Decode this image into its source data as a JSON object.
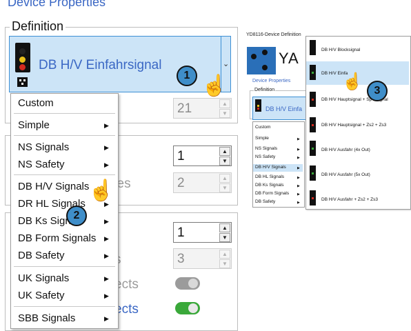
{
  "left": {
    "header": "Device Properties",
    "definition_legend": "Definition",
    "selected_type": "DB H/V Einfahrsignal",
    "id_value": "21",
    "spinner2_value": "1",
    "spinner3_value": "2",
    "ghost_text_1": "ses",
    "spinner4_value": "1",
    "spinner5_value": "3",
    "ghost_text_2": "s",
    "ghost_text_3": "ects",
    "ghost_text_4": "ects",
    "menu": [
      {
        "label": "Custom",
        "submenu": false
      },
      {
        "label": "Simple",
        "submenu": true
      },
      {
        "label": "NS Signals",
        "submenu": true
      },
      {
        "label": "NS Safety",
        "submenu": true
      },
      {
        "label": "DB H/V Signals",
        "submenu": true
      },
      {
        "label": "DR HL Signals",
        "submenu": true
      },
      {
        "label": "DB Ks Signals",
        "submenu": true
      },
      {
        "label": "DB Form Signals",
        "submenu": true
      },
      {
        "label": "DB Safety",
        "submenu": true
      },
      {
        "label": "UK Signals",
        "submenu": true
      },
      {
        "label": "UK Safety",
        "submenu": true
      },
      {
        "label": "SBB Signals",
        "submenu": true
      }
    ],
    "callouts": [
      "1",
      "2"
    ]
  },
  "right": {
    "window_title": "YD8116-Device Definition",
    "logo_text": "YA",
    "header": "Device Properties",
    "definition_legend": "Definition",
    "selected_type": "DB H/V Einfa",
    "menu": [
      {
        "label": "Custom",
        "submenu": false
      },
      {
        "label": "Simple",
        "submenu": true
      },
      {
        "label": "NS Signals",
        "submenu": true
      },
      {
        "label": "NS Safety",
        "submenu": true
      },
      {
        "label": "DB H/V Signals",
        "submenu": true
      },
      {
        "label": "DB HL Signals",
        "submenu": true
      },
      {
        "label": "DB Ks Signals",
        "submenu": true
      },
      {
        "label": "DB Form Signals",
        "submenu": true
      },
      {
        "label": "DB Safety",
        "submenu": true
      }
    ],
    "submenu": [
      "DB H/V Blocksignal",
      "DB H/V Einfa",
      "DB H/V Hauptsignal + Sp",
      "DB H/V Hauptsignal + Zs2 + Zs3",
      "DB H/V Ausfahr (4x Out)",
      "DB H/V Ausfahr (5x Out)",
      "DB H/V Ausfahr + Zs2 + Zs3"
    ],
    "submenu_tail": [
      "ignal"
    ],
    "callout": "3"
  },
  "colors": {
    "accent_blue": "#3a67c4",
    "selection_bg": "#cce4f7",
    "toggle_on": "#3aa83a",
    "toggle_off": "#9b9b9b",
    "callout": "#3f8ec9"
  }
}
